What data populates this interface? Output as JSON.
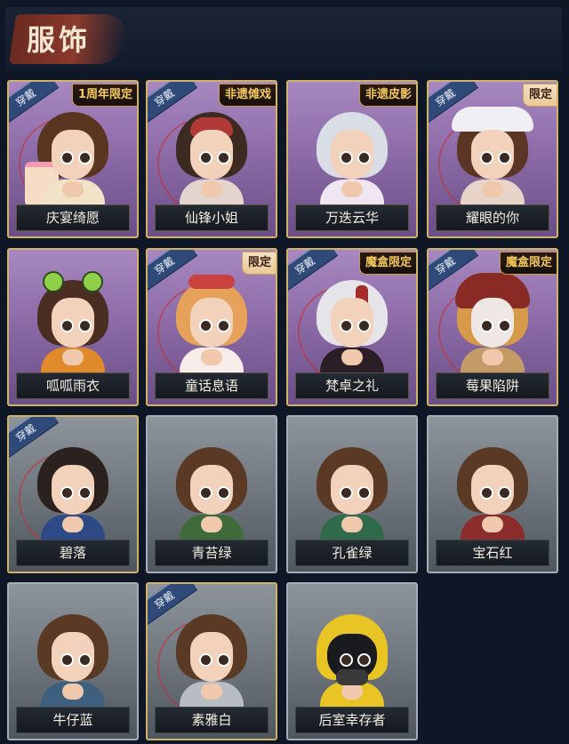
{
  "header": {
    "title": "服饰"
  },
  "labels": {
    "equipped": "穿戴"
  },
  "cards": [
    {
      "name": "庆宴绮愿",
      "equipped": true,
      "badge": "1周年限定",
      "style": "purple",
      "variant": "v-cake"
    },
    {
      "name": "仙锋小姐",
      "equipped": true,
      "badge": "非遗傩戏",
      "style": "purple",
      "variant": "v-redmask"
    },
    {
      "name": "万迭云华",
      "equipped": false,
      "badge": "非遗皮影",
      "style": "purple",
      "variant": "v-silver"
    },
    {
      "name": "耀眼的你",
      "equipped": true,
      "badge": "限定",
      "style": "purple",
      "variant": "v-cowboy"
    },
    {
      "name": "呱呱雨衣",
      "equipped": false,
      "badge": "",
      "style": "purple",
      "variant": "v-frog"
    },
    {
      "name": "童话息语",
      "equipped": true,
      "badge": "限定",
      "style": "purple",
      "variant": "v-fairy"
    },
    {
      "name": "梵卓之礼",
      "equipped": true,
      "badge": "魔盒限定",
      "style": "purple",
      "variant": "v-magic"
    },
    {
      "name": "莓果陷阱",
      "equipped": true,
      "badge": "魔盒限定",
      "style": "purple",
      "variant": "v-berry"
    },
    {
      "name": "碧落",
      "equipped": true,
      "badge": "",
      "style": "grey gold",
      "variant": "v-boy"
    },
    {
      "name": "青苔绿",
      "equipped": false,
      "badge": "",
      "style": "grey",
      "variant": "v-green1"
    },
    {
      "name": "孔雀绿",
      "equipped": false,
      "badge": "",
      "style": "grey",
      "variant": "v-green2"
    },
    {
      "name": "宝石红",
      "equipped": false,
      "badge": "",
      "style": "grey",
      "variant": "v-red"
    },
    {
      "name": "牛仔蓝",
      "equipped": false,
      "badge": "",
      "style": "grey",
      "variant": "v-blue"
    },
    {
      "name": "素雅白",
      "equipped": true,
      "badge": "",
      "style": "grey gold",
      "variant": "v-white"
    },
    {
      "name": "后室幸存者",
      "equipped": false,
      "badge": "",
      "style": "grey",
      "variant": "v-survivor"
    }
  ]
}
